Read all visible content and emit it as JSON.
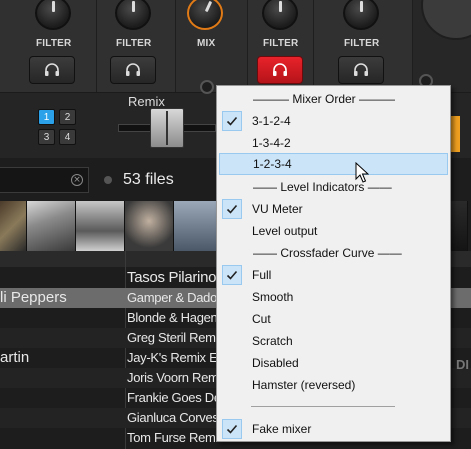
{
  "mixer": {
    "channels": [
      {
        "label": "FILTER",
        "headphone_active": false
      },
      {
        "label": "FILTER",
        "headphone_active": false
      },
      {
        "label": "FILTER",
        "headphone_active": true
      },
      {
        "label": "FILTER",
        "headphone_active": false
      }
    ],
    "mix_label": "MIX",
    "deck_buttons": [
      "1",
      "2",
      "3",
      "4"
    ],
    "selected_deck": "1",
    "accent_color": "#e07a16",
    "cue_active_color": "#e8222a",
    "deck_select_color": "#2aa1e8"
  },
  "browser": {
    "file_count": "53 files",
    "column_header": "Remix",
    "rows": [
      {
        "artist": "",
        "remix": "Tasos Pilarinos"
      },
      {
        "artist": "li Peppers",
        "remix": "Gamper & Dadoni"
      },
      {
        "artist": "",
        "remix": "Blonde & Hagen Remix"
      },
      {
        "artist": "",
        "remix": "Greg Steril Remix"
      },
      {
        "artist": "artin",
        "remix": "Jay-K's Remix Edit"
      },
      {
        "artist": "",
        "remix": "Joris Voorn Remix"
      },
      {
        "artist": "",
        "remix": "Frankie Goes Deep"
      },
      {
        "artist": "",
        "remix": "Gianluca Corvesi Remix"
      },
      {
        "artist": "",
        "remix": "Tom Furse Remix Radio Edit"
      }
    ],
    "side_text": "DI"
  },
  "context_menu": {
    "items": [
      {
        "type": "header",
        "label": "——— Mixer Order ———"
      },
      {
        "type": "item",
        "label": "3-1-2-4",
        "checked": true
      },
      {
        "type": "item",
        "label": "1-3-4-2",
        "checked": false
      },
      {
        "type": "item",
        "label": "1-2-3-4",
        "checked": false,
        "highlighted": true
      },
      {
        "type": "header",
        "label": "—— Level Indicators ——"
      },
      {
        "type": "item",
        "label": "VU Meter",
        "checked": true
      },
      {
        "type": "item",
        "label": "Level output",
        "checked": false
      },
      {
        "type": "header",
        "label": "—— Crossfader Curve ——"
      },
      {
        "type": "item",
        "label": "Full",
        "checked": true
      },
      {
        "type": "item",
        "label": "Smooth",
        "checked": false
      },
      {
        "type": "item",
        "label": "Cut",
        "checked": false
      },
      {
        "type": "item",
        "label": "Scratch",
        "checked": false
      },
      {
        "type": "item",
        "label": "Disabled",
        "checked": false
      },
      {
        "type": "item",
        "label": "Hamster (reversed)",
        "checked": false
      },
      {
        "type": "separator"
      },
      {
        "type": "item",
        "label": "Fake mixer",
        "checked": true
      }
    ]
  }
}
